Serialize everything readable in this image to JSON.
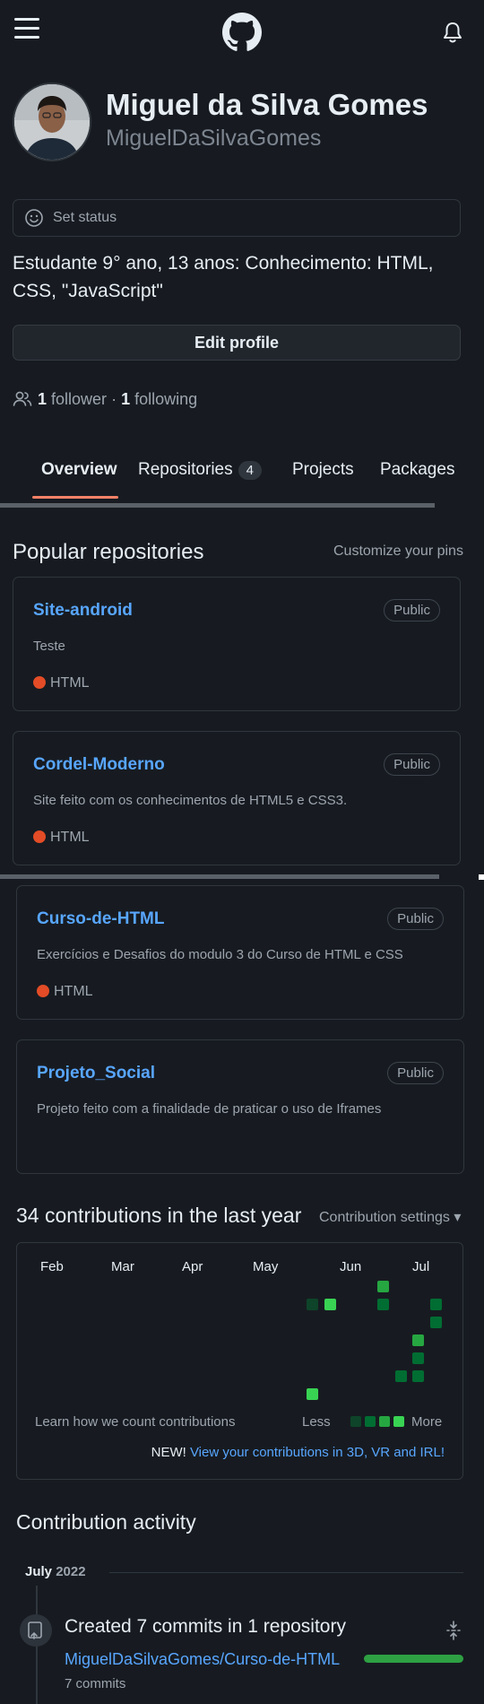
{
  "profile": {
    "name": "Miguel da Silva Gomes",
    "login": "MiguelDaSilvaGomes",
    "status_label": "Set status",
    "bio": "Estudante 9° ano, 13 anos: Conhecimento: HTML, CSS, \"JavaScript\"",
    "edit_label": "Edit profile",
    "followers_count": "1",
    "followers_label": "follower",
    "separator": "·",
    "following_count": "1",
    "following_label": "following"
  },
  "tabs": {
    "overview": "Overview",
    "repositories": "Repositories",
    "repositories_count": "4",
    "projects": "Projects",
    "packages": "Packages"
  },
  "popular": {
    "title": "Popular repositories",
    "customize": "Customize your pins",
    "repos": [
      {
        "name": "Site-android",
        "badge": "Public",
        "desc": "Teste",
        "lang": "HTML"
      },
      {
        "name": "Cordel-Moderno",
        "badge": "Public",
        "desc": "Site feito com os conhecimentos de HTML5 e CSS3.",
        "lang": "HTML"
      },
      {
        "name": "Curso-de-HTML",
        "badge": "Public",
        "desc": "Exercícios e Desafios do modulo 3 do Curso de HTML e CSS",
        "lang": "HTML"
      },
      {
        "name": "Projeto_Social",
        "badge": "Public",
        "desc": "Projeto feito com a finalidade de praticar o uso de Iframes",
        "lang": ""
      }
    ]
  },
  "contributions": {
    "title": "34 contributions in the last year",
    "settings": "Contribution settings",
    "months": [
      "Feb",
      "Mar",
      "Apr",
      "May",
      "Jun",
      "Jul"
    ],
    "learn": "Learn how we count contributions",
    "less": "Less",
    "more": "More",
    "new_prefix": "NEW!",
    "new_link": "View your contributions in 3D, VR and IRL!"
  },
  "activity": {
    "title": "Contribution activity",
    "month": "July",
    "year": "2022",
    "summary": "Created 7 commits in 1 repository",
    "repo": "MiguelDaSilvaGomes/Curso-de-HTML",
    "commits": "7 commits",
    "commit_share": 1.0
  },
  "colors": {
    "background": "#171b21",
    "link": "#58a6ff",
    "accent_underline": "#f78166",
    "html_lang": "#e34c26",
    "contrib_levels": [
      "#0e4429",
      "#006d32",
      "#26a641",
      "#39d353"
    ]
  },
  "icons": [
    "menu-icon",
    "github-logo-icon",
    "bell-icon",
    "smiley-icon",
    "people-icon",
    "caret-down-icon",
    "repo-push-icon",
    "fold-icon"
  ]
}
